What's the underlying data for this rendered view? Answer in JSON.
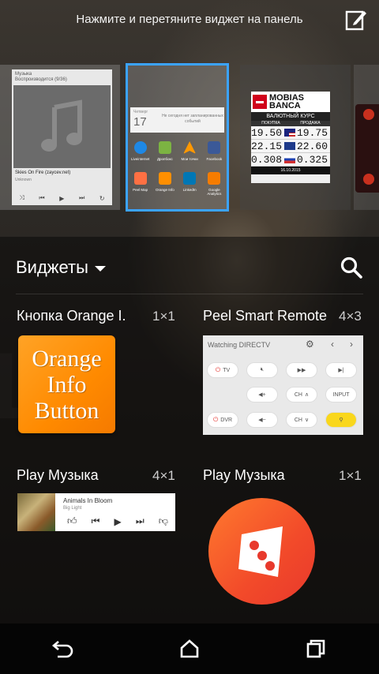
{
  "hint_text": "Нажмите и перетяните виджет на панель",
  "icons": {
    "edit": "edit-icon",
    "search": "search-icon",
    "back": "back-icon",
    "home": "home-icon",
    "recents": "recents-icon"
  },
  "accent_color": "#3ba3ff",
  "panels": {
    "music_mini": {
      "app": "Музыка",
      "status": "Воспроизводится (9/36)",
      "track": "Skies On Fire (zaycev.net)",
      "artist": "Unknown"
    },
    "calendar_apps": {
      "day_label": "Четверг",
      "day_number": "17",
      "event_text": "Не сегодня нет запланированных событий",
      "apps": [
        "Liveinternet",
        "Дропбокс",
        "Мои точки",
        "Facebook",
        "Peel Map",
        "Orange Info",
        "LinkedIn",
        "Google Analytics"
      ]
    },
    "bank": {
      "brand_line1": "MOBIAS",
      "brand_line2": "BANCA",
      "title": "ВАЛЮТНЫЙ КУРС",
      "col_buy": "ПОКУПКА",
      "col_sell": "ПРОДАЖА",
      "rows": [
        {
          "buy": "19.50",
          "sell": "19.75"
        },
        {
          "buy": "22.15",
          "sell": "22.60"
        },
        {
          "buy": "0.308",
          "sell": "0.325"
        }
      ],
      "date": "16.10.2015"
    }
  },
  "drawer": {
    "title": "Виджеты",
    "widgets": [
      {
        "name": "Кнопка Orange I.",
        "size": "1×1"
      },
      {
        "name": "Peel Smart Remote",
        "size": "4×3"
      },
      {
        "name": "Play Музыка",
        "size": "4×1"
      },
      {
        "name": "Play Музыка",
        "size": "1×1"
      }
    ],
    "orange_button": [
      "Orange",
      "Info",
      "Button"
    ],
    "peel": {
      "title": "Watching DIRECTV",
      "tv": "TV",
      "dvr": "DVR",
      "ch": "CH",
      "input": "INPUT"
    },
    "play_bar": {
      "track": "Animals In Bloom",
      "artist": "Big Light"
    }
  }
}
